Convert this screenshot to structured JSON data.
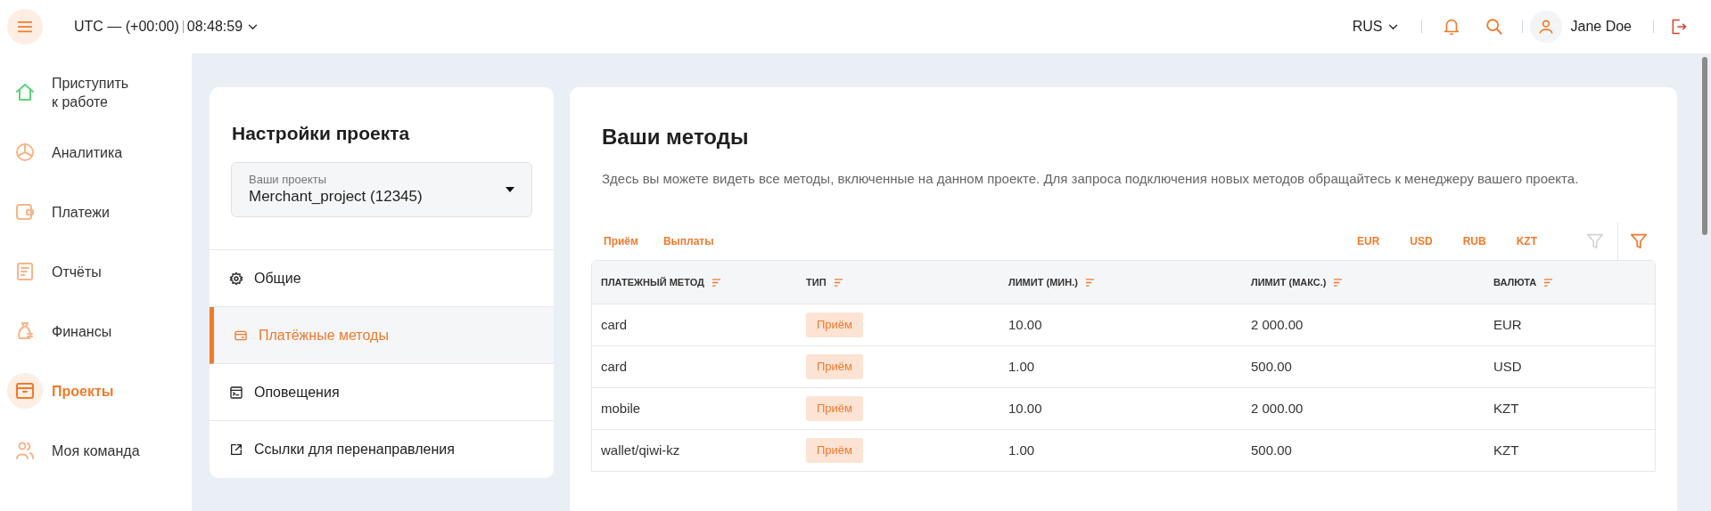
{
  "header": {
    "timezone": "UTC — (+00:00)",
    "time": "08:48:59",
    "language": "RUS",
    "user": "Jane Doe"
  },
  "sidebar": {
    "items": [
      {
        "label": "Приступить\nк работе",
        "kind": "home",
        "selected": false
      },
      {
        "label": "Аналитика",
        "kind": "pie",
        "selected": false
      },
      {
        "label": "Платежи",
        "kind": "wallet",
        "selected": false
      },
      {
        "label": "Отчёты",
        "kind": "report",
        "selected": false
      },
      {
        "label": "Финансы",
        "kind": "bag",
        "selected": false
      },
      {
        "label": "Проекты",
        "kind": "box",
        "selected": true
      },
      {
        "label": "Моя команда",
        "kind": "team",
        "selected": false
      }
    ]
  },
  "settings": {
    "title": "Настройки проекта",
    "project_select": {
      "label": "Ваши проекты",
      "value": "Merchant_project (12345)"
    },
    "menu": [
      {
        "label": "Общие",
        "kind": "gear",
        "selected": false
      },
      {
        "label": "Платёжные методы",
        "kind": "card",
        "selected": true
      },
      {
        "label": "Оповещения",
        "kind": "terminal",
        "selected": false
      },
      {
        "label": "Ссылки для перенаправления",
        "kind": "external",
        "selected": false
      }
    ]
  },
  "methods": {
    "title": "Ваши методы",
    "description": "Здесь вы можете видеть все методы, включенные на данном проекте. Для запроса подключения новых методов обращайтесь к менеджеру вашего проекта.",
    "type_filters": [
      "Приём",
      "Выплаты"
    ],
    "currency_filters": [
      "EUR",
      "USD",
      "RUB",
      "KZT"
    ],
    "columns": [
      "ПЛАТЕЖНЫЙ МЕТОД",
      "ТИП",
      "ЛИМИТ (МИН.)",
      "ЛИМИТ (МАКС.)",
      "ВАЛЮТА"
    ],
    "rows": [
      {
        "method": "card",
        "type": "Приём",
        "min": "10.00",
        "max": "2 000.00",
        "currency": "EUR"
      },
      {
        "method": "card",
        "type": "Приём",
        "min": "1.00",
        "max": "500.00",
        "currency": "USD"
      },
      {
        "method": "mobile",
        "type": "Приём",
        "min": "10.00",
        "max": "2 000.00",
        "currency": "KZT"
      },
      {
        "method": "wallet/qiwi-kz",
        "type": "Приём",
        "min": "1.00",
        "max": "500.00",
        "currency": "KZT"
      }
    ]
  }
}
